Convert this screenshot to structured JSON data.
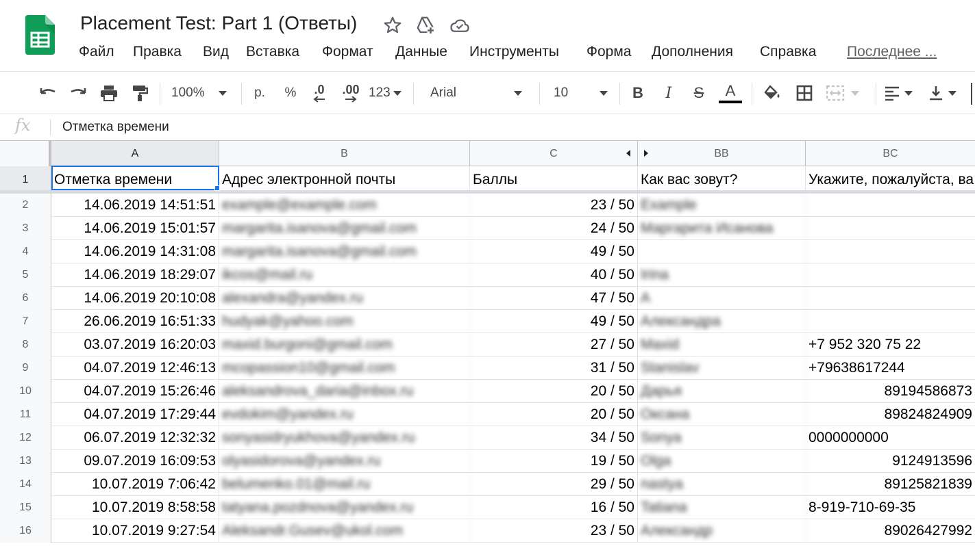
{
  "title": {
    "doc_title": "Placement Test: Part 1 (Ответы)",
    "icons": [
      "star-icon",
      "move-to-drive-icon",
      "cloud-saved-icon"
    ]
  },
  "menu": {
    "file": "Файл",
    "edit": "Правка",
    "view": "Вид",
    "insert": "Вставка",
    "format": "Формат",
    "data": "Данные",
    "tools": "Инструменты",
    "form": "Форма",
    "addons": "Дополнения",
    "help": "Справка",
    "last_edit": "Последнее ..."
  },
  "toolbar": {
    "zoom": "100%",
    "currency": "р.",
    "percent": "%",
    "dec_less": ".0",
    "dec_more": ".00",
    "more_formats": "123",
    "font": "Arial",
    "font_size": "10",
    "bold": "B",
    "italic": "I",
    "strike": "S",
    "text_color": "A",
    "text_color_value": "#000000"
  },
  "formula_bar": {
    "fx": "fx",
    "content": "Отметка времени"
  },
  "grid": {
    "columns": [
      "A",
      "B",
      "C",
      "BB",
      "BC"
    ],
    "header_row": {
      "num": "1",
      "a": "Отметка времени",
      "b": "Адрес электронной почты",
      "c": "Баллы",
      "bb": "Как вас зовут?",
      "bc": "Укажите, пожалуйста, ва"
    },
    "rows": [
      {
        "num": "2",
        "time": "14.06.2019 14:51:51",
        "email": "example@example.com",
        "score": "23 / 50",
        "name": "Example",
        "phone": "",
        "phone_align": "left"
      },
      {
        "num": "3",
        "time": "14.06.2019 15:01:57",
        "email": "margarita.isanova@gmail.com",
        "score": "24 / 50",
        "name": "Маргарита Исанова",
        "phone": "",
        "phone_align": "left"
      },
      {
        "num": "4",
        "time": "14.06.2019 14:31:08",
        "email": "margarita.isanova@gmail.com",
        "score": "49 / 50",
        "name": "",
        "phone": "",
        "phone_align": "left"
      },
      {
        "num": "5",
        "time": "14.06.2019 18:29:07",
        "email": "ikcos@mail.ru",
        "score": "40 / 50",
        "name": "Irina",
        "phone": "",
        "phone_align": "left"
      },
      {
        "num": "6",
        "time": "14.06.2019 20:10:08",
        "email": "alexandra@yandex.ru",
        "score": "47 / 50",
        "name": "A",
        "phone": "",
        "phone_align": "left"
      },
      {
        "num": "7",
        "time": "26.06.2019 16:51:33",
        "email": "hudyak@yahoo.com",
        "score": "49 / 50",
        "name": "Александра",
        "phone": "",
        "phone_align": "left"
      },
      {
        "num": "8",
        "time": "03.07.2019 16:20:03",
        "email": "maxid.burgoni@gmail.com",
        "score": "27 / 50",
        "name": "Maxid",
        "phone": "+7 952 320 75 22",
        "phone_align": "left"
      },
      {
        "num": "9",
        "time": "04.07.2019 12:46:13",
        "email": "mcopassion10@gmail.com",
        "score": "31 / 50",
        "name": "Stanislav",
        "phone": "+79638617244",
        "phone_align": "left"
      },
      {
        "num": "10",
        "time": "04.07.2019 15:26:46",
        "email": "aleksandrova_daria@inbox.ru",
        "score": "20 / 50",
        "name": "Дарья",
        "phone": "89194586873",
        "phone_align": "right"
      },
      {
        "num": "11",
        "time": "04.07.2019 17:29:44",
        "email": "evdokim@yandex.ru",
        "score": "20 / 50",
        "name": "Оксана",
        "phone": "89824824909",
        "phone_align": "right"
      },
      {
        "num": "12",
        "time": "06.07.2019 12:32:32",
        "email": "sonyasidryukhova@yandex.ru",
        "score": "34 / 50",
        "name": "Sonya",
        "phone": "0000000000",
        "phone_align": "left"
      },
      {
        "num": "13",
        "time": "09.07.2019 16:09:53",
        "email": "olyasidorova@yandex.ru",
        "score": "19 / 50",
        "name": "Olga",
        "phone": "9124913596",
        "phone_align": "right"
      },
      {
        "num": "14",
        "time": "10.07.2019 7:06:42",
        "email": "belumenko.01@mail.ru",
        "score": "29 / 50",
        "name": "nastya",
        "phone": "89125821839",
        "phone_align": "right"
      },
      {
        "num": "15",
        "time": "10.07.2019 8:58:58",
        "email": "tatyana.pozdnova@yandex.ru",
        "score": "16 / 50",
        "name": "Tatiana",
        "phone": "8-919-710-69-35",
        "phone_align": "left"
      },
      {
        "num": "16",
        "time": "10.07.2019 9:27:54",
        "email": "Aleksandr.Gusev@ukol.com",
        "score": "23 / 50",
        "name": "Александр",
        "phone": "89026427992",
        "phone_align": "right"
      }
    ]
  },
  "colors": {
    "accent": "#1a73e8",
    "sheets_green": "#0f9d58"
  }
}
